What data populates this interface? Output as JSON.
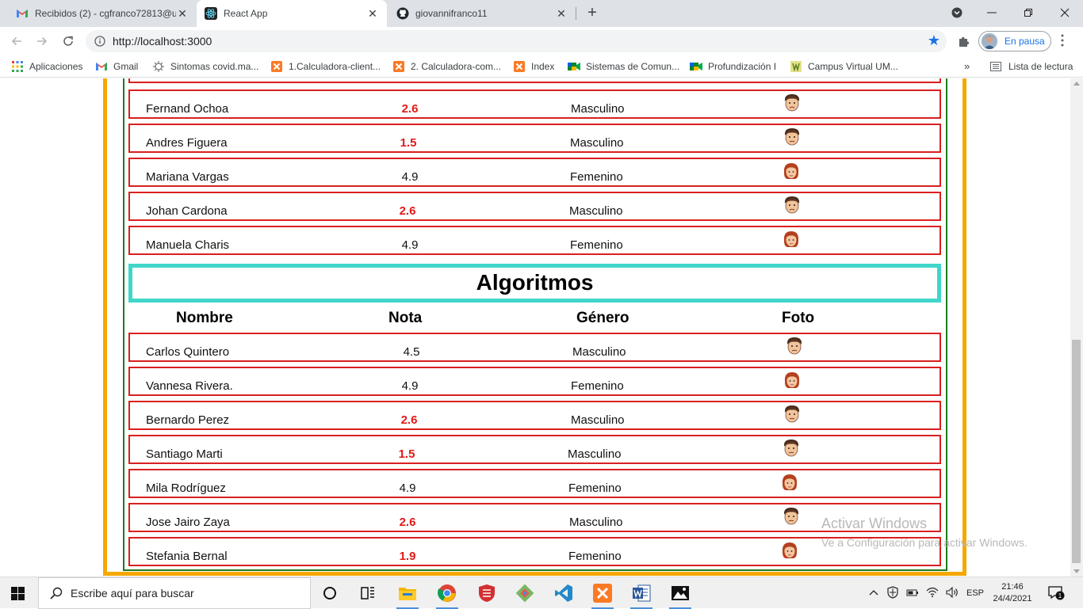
{
  "browser": {
    "tabs": [
      {
        "title": "Recibidos (2) - cgfranco72813@u",
        "icon": "gmail-icon",
        "active": false
      },
      {
        "title": "React App",
        "icon": "react-icon",
        "active": true
      },
      {
        "title": "giovannifranco11",
        "icon": "github-icon",
        "active": false
      }
    ],
    "new_tab": "+",
    "url": "http://localhost:3000",
    "profile_label": "En pausa",
    "bookmarks": [
      {
        "label": "Aplicaciones",
        "icon": "apps-grid-icon"
      },
      {
        "label": "Gmail",
        "icon": "gmail-icon"
      },
      {
        "label": "Sintomas covid.ma...",
        "icon": "virus-icon"
      },
      {
        "label": "1.Calculadora-client...",
        "icon": "xampp-icon"
      },
      {
        "label": "2. Calculadora-com...",
        "icon": "xampp-icon"
      },
      {
        "label": "Index",
        "icon": "xampp-icon"
      },
      {
        "label": "Sistemas de Comun...",
        "icon": "meet-icon"
      },
      {
        "label": "Profundización I",
        "icon": "meet-icon"
      },
      {
        "label": "Campus Virtual UM...",
        "icon": "campus-icon"
      }
    ],
    "bookmarks_more": "»",
    "reading_list": "Lista de lectura"
  },
  "colors": {
    "outer_border": "#f5a800",
    "inner_border": "#1c7c1c",
    "row_border": "#d9201f",
    "title_border": "#40d6c9",
    "fail_grade": "#e01919"
  },
  "page": {
    "section_top_rows": [
      {
        "name": "Fernand Ochoa",
        "grade": "2.6",
        "gender": "Masculino",
        "photo": "male-avatar-icon",
        "fail": true
      },
      {
        "name": "Andres Figuera",
        "grade": "1.5",
        "gender": "Masculino",
        "photo": "male-avatar-icon",
        "fail": true
      },
      {
        "name": "Mariana Vargas",
        "grade": "4.9",
        "gender": "Femenino",
        "photo": "female-avatar-icon",
        "fail": false
      },
      {
        "name": "Johan Cardona",
        "grade": "2.6",
        "gender": "Masculino",
        "photo": "male-avatar-icon",
        "fail": true
      },
      {
        "name": "Manuela Charis",
        "grade": "4.9",
        "gender": "Femenino",
        "photo": "female-avatar-icon",
        "fail": false
      }
    ],
    "section_title": "Algoritmos",
    "headers": {
      "name": "Nombre",
      "grade": "Nota",
      "gender": "Género",
      "photo": "Foto"
    },
    "section_rows": [
      {
        "name": "Carlos Quintero",
        "grade": "4.5",
        "gender": "Masculino",
        "photo": "male-avatar-icon",
        "fail": false
      },
      {
        "name": "Vannesa Rivera.",
        "grade": "4.9",
        "gender": "Femenino",
        "photo": "female-avatar-icon",
        "fail": false
      },
      {
        "name": "Bernardo Perez",
        "grade": "2.6",
        "gender": "Masculino",
        "photo": "male-avatar-icon",
        "fail": true
      },
      {
        "name": "Santiago Marti",
        "grade": "1.5",
        "gender": "Masculino",
        "photo": "male-avatar-icon",
        "fail": true
      },
      {
        "name": "Mila Rodríguez",
        "grade": "4.9",
        "gender": "Femenino",
        "photo": "female-avatar-icon",
        "fail": false
      },
      {
        "name": "Jose Jairo Zaya",
        "grade": "2.6",
        "gender": "Masculino",
        "photo": "male-avatar-icon",
        "fail": true
      },
      {
        "name": "Stefania Bernal",
        "grade": "1.9",
        "gender": "Femenino",
        "photo": "female-avatar-icon",
        "fail": true
      }
    ]
  },
  "watermark": {
    "line1": "Activar Windows",
    "line2": "Ve a Configuración para activar Windows."
  },
  "taskbar": {
    "search_placeholder": "Escribe aquí para buscar",
    "apps": [
      "cortana-icon",
      "task-view-icon",
      "file-explorer-icon",
      "chrome-icon",
      "shield-app-icon",
      "git-icon",
      "vscode-icon",
      "xampp-icon",
      "word-icon",
      "photos-icon"
    ],
    "language": "ESP",
    "time": "21:46",
    "date": "24/4/2021",
    "notification_count": "1"
  }
}
